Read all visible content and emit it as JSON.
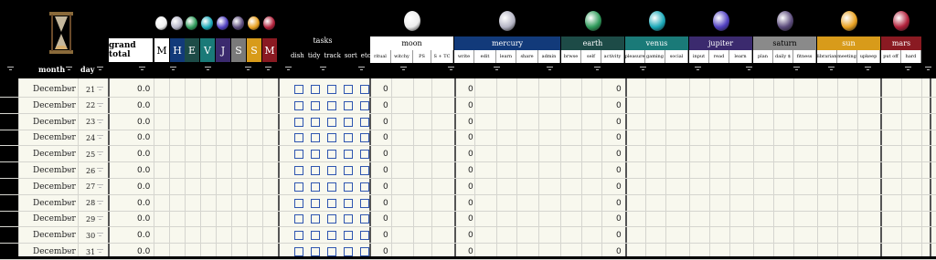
{
  "header": {
    "grand_total_label": "grand total",
    "tasks_label": "tasks",
    "tasks_sublabels": [
      "dish",
      "tidy",
      "track",
      "sort",
      "etc."
    ],
    "filter_headers": {
      "month": "month",
      "day": "day"
    }
  },
  "gems": [
    {
      "letter": "M",
      "color": "#f0f0f0",
      "bg": "#ffffff",
      "fg": "#000000"
    },
    {
      "letter": "H",
      "color": "#b6b6c8",
      "bg": "#123a7a",
      "fg": "#ffffff"
    },
    {
      "letter": "E",
      "color": "#2e9a5a",
      "bg": "#1d4b47",
      "fg": "#ffffff"
    },
    {
      "letter": "V",
      "color": "#1aa8b8",
      "bg": "#1a7a78",
      "fg": "#ffffff"
    },
    {
      "letter": "J",
      "color": "#5040c0",
      "bg": "#3b2a6e",
      "fg": "#ffffff"
    },
    {
      "letter": "S",
      "color": "#5a4a7a",
      "bg": "#7a7a7a",
      "fg": "#ffffff"
    },
    {
      "letter": "S",
      "color": "#e8a020",
      "bg": "#d89b1a",
      "fg": "#ffffff"
    },
    {
      "letter": "M",
      "color": "#b0203a",
      "bg": "#8a1a22",
      "fg": "#ffffff"
    }
  ],
  "planets": [
    {
      "name": "moon",
      "bg": "#ffffff",
      "fg": "#000000",
      "gem": "#ececec",
      "subs": [
        "ritual",
        "witchy",
        "PS",
        "S + TC"
      ]
    },
    {
      "name": "mercury",
      "bg": "#123a7a",
      "fg": "#ffffff",
      "gem": "#b4b4c4",
      "subs": [
        "write",
        "edit",
        "learn",
        "share",
        "admin"
      ]
    },
    {
      "name": "earth",
      "bg": "#1d4b47",
      "fg": "#ffffff",
      "gem": "#2e9a5a",
      "subs": [
        "brwse",
        "self",
        "activity"
      ]
    },
    {
      "name": "venus",
      "bg": "#1a7a78",
      "fg": "#ffffff",
      "gem": "#1aa8b8",
      "subs": [
        "pleasure",
        "gaming",
        "social"
      ]
    },
    {
      "name": "jupiter",
      "bg": "#3b2a6e",
      "fg": "#ffffff",
      "gem": "#5040c0",
      "subs": [
        "input",
        "read",
        "learn"
      ]
    },
    {
      "name": "saturn",
      "bg": "#8a8a8a",
      "fg": "#000000",
      "gem": "#5a4a7a",
      "subs": [
        "plan",
        "daily $",
        "fitness"
      ]
    },
    {
      "name": "sun",
      "bg": "#d89b1a",
      "fg": "#ffffff",
      "gem": "#e8a020",
      "subs": [
        "librarian",
        "meeting",
        "upkeep"
      ]
    },
    {
      "name": "mars",
      "bg": "#8a1a22",
      "fg": "#ffffff",
      "gem": "#b0203a",
      "subs": [
        "put off",
        "hard"
      ]
    }
  ],
  "rows": [
    {
      "month": "December",
      "day": "21",
      "total": "0.0",
      "moon": "0",
      "mercury": "0",
      "earth": "0"
    },
    {
      "month": "December",
      "day": "22",
      "total": "0.0",
      "moon": "0",
      "mercury": "0",
      "earth": "0"
    },
    {
      "month": "December",
      "day": "23",
      "total": "0.0",
      "moon": "0",
      "mercury": "0",
      "earth": "0"
    },
    {
      "month": "December",
      "day": "24",
      "total": "0.0",
      "moon": "0",
      "mercury": "0",
      "earth": "0"
    },
    {
      "month": "December",
      "day": "25",
      "total": "0.0",
      "moon": "0",
      "mercury": "0",
      "earth": "0"
    },
    {
      "month": "December",
      "day": "26",
      "total": "0.0",
      "moon": "0",
      "mercury": "0",
      "earth": "0"
    },
    {
      "month": "December",
      "day": "27",
      "total": "0.0",
      "moon": "0",
      "mercury": "0",
      "earth": "0"
    },
    {
      "month": "December",
      "day": "28",
      "total": "0.0",
      "moon": "0",
      "mercury": "0",
      "earth": "0"
    },
    {
      "month": "December",
      "day": "29",
      "total": "0.0",
      "moon": "0",
      "mercury": "0",
      "earth": "0"
    },
    {
      "month": "December",
      "day": "30",
      "total": "0.0",
      "moon": "0",
      "mercury": "0",
      "earth": "0"
    },
    {
      "month": "December",
      "day": "31",
      "total": "0.0",
      "moon": "0",
      "mercury": "0",
      "earth": "0"
    }
  ]
}
